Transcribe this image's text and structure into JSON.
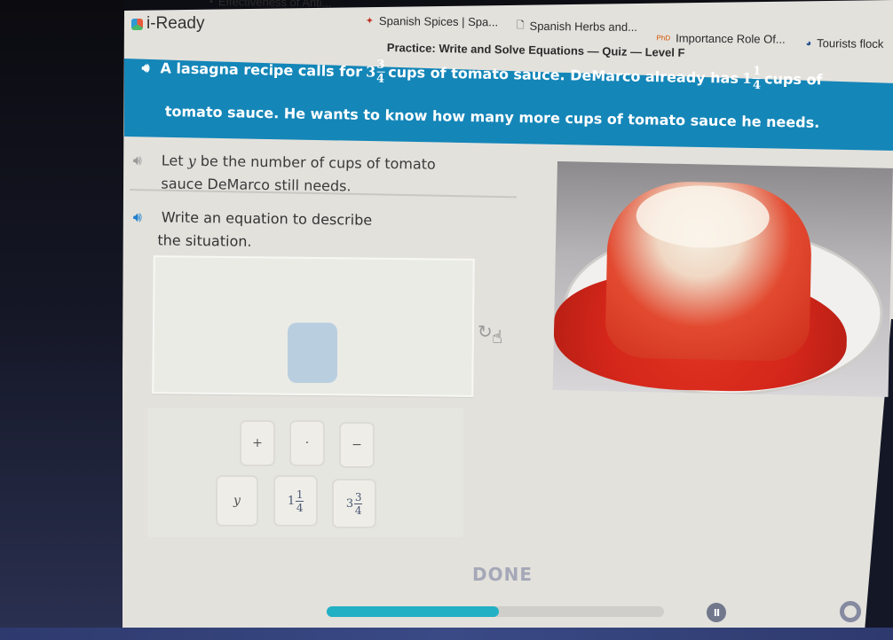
{
  "browser": {
    "bookmarks": [
      {
        "label": "Effectiveness of Anti...",
        "icon": "bookmark-icon"
      },
      {
        "label": "Spanish Spices | Spa...",
        "icon": "site-icon"
      },
      {
        "label": "Spanish Herbs and...",
        "icon": "document-icon"
      },
      {
        "label": "Importance Role Of...",
        "icon": "site-icon"
      },
      {
        "label": "Tourists flock",
        "icon": "site-icon"
      }
    ]
  },
  "app": {
    "logo": "i-Ready",
    "subtitle": "Practice: Write and Solve Equations — Quiz — Level F"
  },
  "question": {
    "line1_a": "A lasagna recipe calls for",
    "frac1": {
      "whole": "3",
      "num": "3",
      "den": "4"
    },
    "line1_b": "cups of tomato sauce. DeMarco already has",
    "frac2": {
      "whole": "1",
      "num": "1",
      "den": "4"
    },
    "line1_c": "cups of",
    "line2": "tomato sauce. He wants to know how many more cups of tomato sauce he needs."
  },
  "prompts": {
    "let_line1_a": "Let",
    "let_var": "y",
    "let_line1_b": "be the number of cups of tomato",
    "let_line2": "sauce DeMarco still needs.",
    "write_line1": "Write an equation to describe",
    "write_line2": "the situation."
  },
  "tiles": {
    "plus": "+",
    "dot": "·",
    "minus": "−",
    "var": "y",
    "frac_a": {
      "whole": "1",
      "num": "1",
      "den": "4"
    },
    "frac_b": {
      "whole": "3",
      "num": "3",
      "den": "4"
    }
  },
  "controls": {
    "done_label": "DONE",
    "progress_percent": 51,
    "pause_label": "II"
  },
  "colors": {
    "banner": "#1486b8",
    "progress": "#22b0c4",
    "answer_slot": "#b9cfe0"
  }
}
